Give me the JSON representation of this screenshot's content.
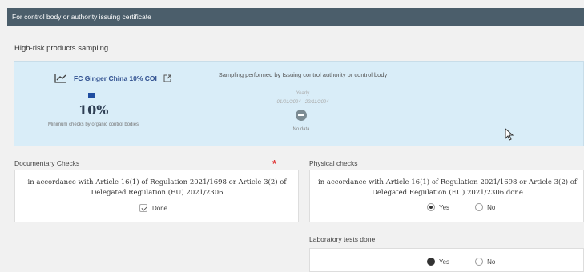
{
  "header": {
    "title": "For control body or authority issuing certificate"
  },
  "section": {
    "title": "High-risk products sampling"
  },
  "sampling": {
    "product_name": "FC Ginger China 10% COI",
    "percentage": "10%",
    "percentage_caption": "Minimum checks by organic control bodies",
    "performed_by": "Sampling performed by Issuing control authority or control body",
    "frequency": "Yearly",
    "period": "01/01/2024 - 22/11/2024",
    "status_text": "No data"
  },
  "documentary": {
    "label": "Documentary Checks",
    "required_mark": "*",
    "text": "in accordance with Article 16(1) of Regulation 2021/1698 or Article 3(2) of Delegated Regulation (EU) 2021/2306",
    "done_label": "Done"
  },
  "physical": {
    "label": "Physical checks",
    "text": "in accordance with Article 16(1) of Regulation 2021/1698 or Article 3(2) of Delegated Regulation (EU) 2021/2306 done",
    "yes_label": "Yes",
    "no_label": "No",
    "selected": "Yes"
  },
  "laboratory": {
    "label": "Laboratory tests done",
    "yes_label": "Yes",
    "no_label": "No",
    "selected": "Yes"
  },
  "icons": {
    "chart": "line-chart-icon",
    "external_link": "external-link-icon",
    "flag": "flag-icon",
    "status": "minus-circle-icon",
    "cursor": "mouse-cursor-icon"
  }
}
